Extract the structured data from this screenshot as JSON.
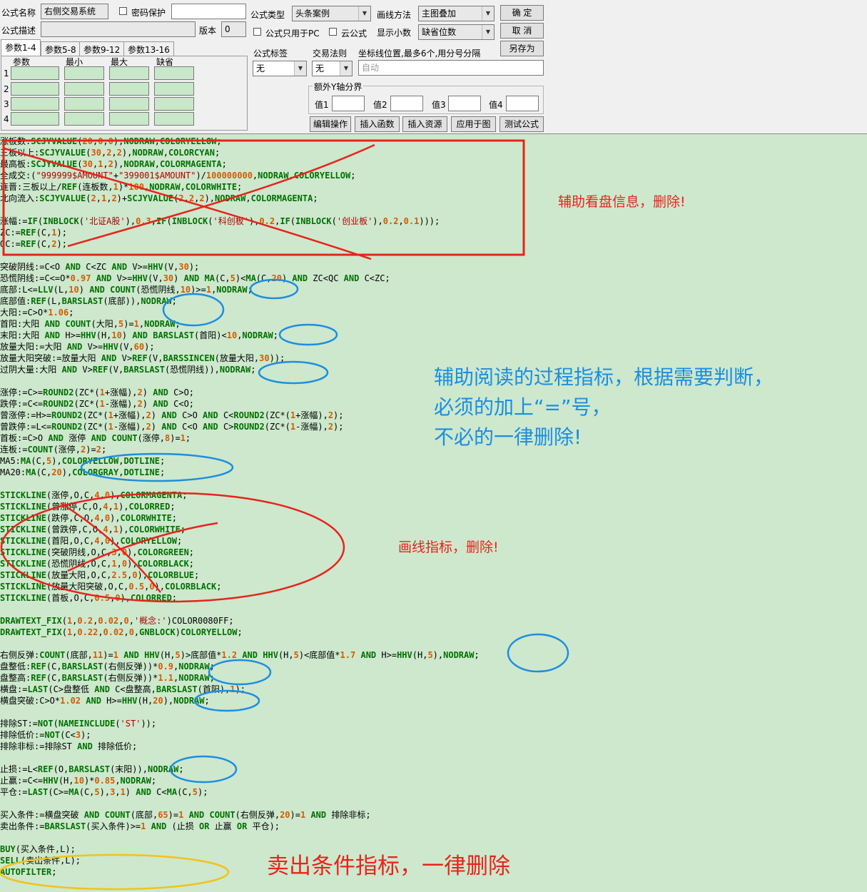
{
  "form": {
    "name_label": "公式名称",
    "name_value": "右侧交易系统",
    "password_label": "密码保护",
    "desc_label": "公式描述",
    "version_label": "版本",
    "version_value": "0",
    "type_label": "公式类型",
    "type_value": "头条案例",
    "draw_label": "画线方法",
    "draw_value": "主图叠加",
    "pc_only_label": "公式只用于PC",
    "cloud_label": "云公式",
    "decimals_label": "显示小数",
    "decimals_value": "缺省位数",
    "tag_label": "公式标签",
    "tag_value": "无",
    "rule_label": "交易法则",
    "rule_value": "无",
    "coord_label": "坐标线位置,最多6个,用分号分隔",
    "coord_placeholder": "自动",
    "yaxis_label": "额外Y轴分界",
    "v1_label": "值1",
    "v2_label": "值2",
    "v3_label": "值3",
    "v4_label": "值4"
  },
  "buttons": {
    "ok": "确  定",
    "cancel": "取  消",
    "save_as": "另存为",
    "edit_ops": "编辑操作",
    "insert_func": "插入函数",
    "insert_res": "插入资源",
    "apply": "应用于图",
    "test": "测试公式"
  },
  "tabs": [
    "参数1-4",
    "参数5-8",
    "参数9-12",
    "参数13-16"
  ],
  "params": {
    "headers": [
      "参数",
      "最小",
      "最大",
      "缺省"
    ],
    "rows": [
      "1",
      "2",
      "3",
      "4"
    ]
  },
  "annotations": {
    "info": "辅助看盘信息，删除!",
    "process_1": "辅助阅读的过程指标，根据需要判断，",
    "process_2": "必须的加上“=”号，",
    "process_3": "不必的一律删除!",
    "draw": "画线指标，删除!",
    "sell": "卖出条件指标，一律删除"
  },
  "code_lines": [
    "涨板数:SCJYVALUE(20,0,0),NODRAW,COLORYELLOW;",
    "三板以上:SCJYVALUE(30,2,2),NODRAW,COLORCYAN;",
    "最高板:SCJYVALUE(30,1,2),NODRAW,COLORMAGENTA;",
    "全成交:(\"999999$AMOUNT\"+\"399001$AMOUNT\")/100000000,NODRAW,COLORYELLOW;",
    "连晋:三板以上/REF(连板数,1)*100,NODRAW,COLORWHITE;",
    "北向流入:SCJYVALUE(2,1,2)+SCJYVALUE(2,2,2),NODRAW,COLORMAGENTA;",
    "",
    "涨幅:=IF(INBLOCK('北证A股'),0.3,IF(INBLOCK('科创板'),0.2,IF(INBLOCK('创业板'),0.2,0.1)));",
    "ZC:=REF(C,1);",
    "QC:=REF(C,2);",
    "",
    "突破阴线:=C<O AND C<ZC AND V>=HHV(V,30);",
    "恐慌阴线:=C<=O*0.97 AND V>=HHV(V,30) AND MA(C,5)<MA(C,20) AND ZC<QC AND C<ZC;",
    "底部:L<=LLV(L,10) AND COUNT(恐慌阴线,10)>=1,NODRAW;",
    "底部值:REF(L,BARSLAST(底部)),NODRAW;",
    "大阳:=C>O*1.06;",
    "首阳:大阳 AND COUNT(大阳,5)=1,NODRAW;",
    "末阳:大阳 AND H>=HHV(H,10) AND BARSLAST(首阳)<10,NODRAW;",
    "放量大阳:=大阳 AND V>=HHV(V,60);",
    "放量大阳突破:=放量大阳 AND V>REF(V,BARSSINCEN(放量大阳,30));",
    "过阴大量:大阳 AND V>REF(V,BARSLAST(恐慌阴线)),NODRAW;",
    "",
    "涨停:=C>=ROUND2(ZC*(1+涨幅),2) AND C>O;",
    "跌停:=C<=ROUND2(ZC*(1-涨幅),2) AND C<O;",
    "曾涨停:=H>=ROUND2(ZC*(1+涨幅),2) AND C>O AND C<ROUND2(ZC*(1+涨幅),2);",
    "曾跌停:=L<=ROUND2(ZC*(1-涨幅),2) AND C<O AND C>ROUND2(ZC*(1-涨幅),2);",
    "首板:=C>O AND 涨停 AND COUNT(涨停,8)=1;",
    "连板:=COUNT(涨停,2)=2;",
    "MA5:MA(C,5),COLORYELLOW,DOTLINE;",
    "MA20:MA(C,20),COLORGRAY,DOTLINE;",
    "",
    "STICKLINE(涨停,O,C,4,0),COLORMAGENTA;",
    "STICKLINE(曾涨停,C,O,4,1),COLORRED;",
    "STICKLINE(跌停,C,O,4,0),COLORWHITE;",
    "STICKLINE(曾跌停,C,O,4,1),COLORWHITE;",
    "STICKLINE(首阳,O,C,4,0),COLORYELLOW;",
    "STICKLINE(突破阴线,O,C,3,0),COLORGREEN;",
    "STICKLINE(恐慌阴线,O,C,1,0),COLORBLACK;",
    "STICKLINE(放量大阳,O,C,2.5,0),COLORBLUE;",
    "STICKLINE(放量大阳突破,O,C,0.5,0),COLORBLACK;",
    "STICKLINE(首板,O,C,0.5,0),COLORRED;",
    "",
    "DRAWTEXT_FIX(1,0.2,0.02,0,'概念:')COLOR0080FF;",
    "DRAWTEXT_FIX(1,0.22,0.02,0,GNBLOCK)COLORYELLOW;",
    "",
    "右侧反弹:COUNT(底部,11)=1 AND HHV(H,5)>底部值*1.2 AND HHV(H,5)<底部值*1.7 AND H>=HHV(H,5),NODRAW;",
    "盘整低:REF(C,BARSLAST(右侧反弹))*0.9,NODRAW;",
    "盘整高:REF(C,BARSLAST(右侧反弹))*1.1,NODRAW;",
    "横盘:=LAST(C>盘整低 AND C<盘整高,BARSLAST(首阳),1);",
    "横盘突破:C>O*1.02 AND H>=HHV(H,20),NODRAW;",
    "",
    "排除ST:=NOT(NAMEINCLUDE('ST'));",
    "排除低价:=NOT(C<3);",
    "排除非标:=排除ST AND 排除低价;",
    "",
    "止损:=L<REF(O,BARSLAST(末阳)),NODRAW;",
    "止赢:=C<=HHV(H,10)*0.85,NODRAW;",
    "平仓:=LAST(C>=MA(C,5),3,1) AND C<MA(C,5);",
    "",
    "买入条件:=横盘突破 AND COUNT(底部,65)=1 AND COUNT(右侧反弹,20)=1 AND 排除非标;",
    "卖出条件:=BARSLAST(买入条件)>=1 AND (止损 OR 止赢 OR 平仓);",
    "",
    "BUY(买入条件,L);",
    "SELL(卖出条件,L);",
    "AUTOFILTER;"
  ]
}
